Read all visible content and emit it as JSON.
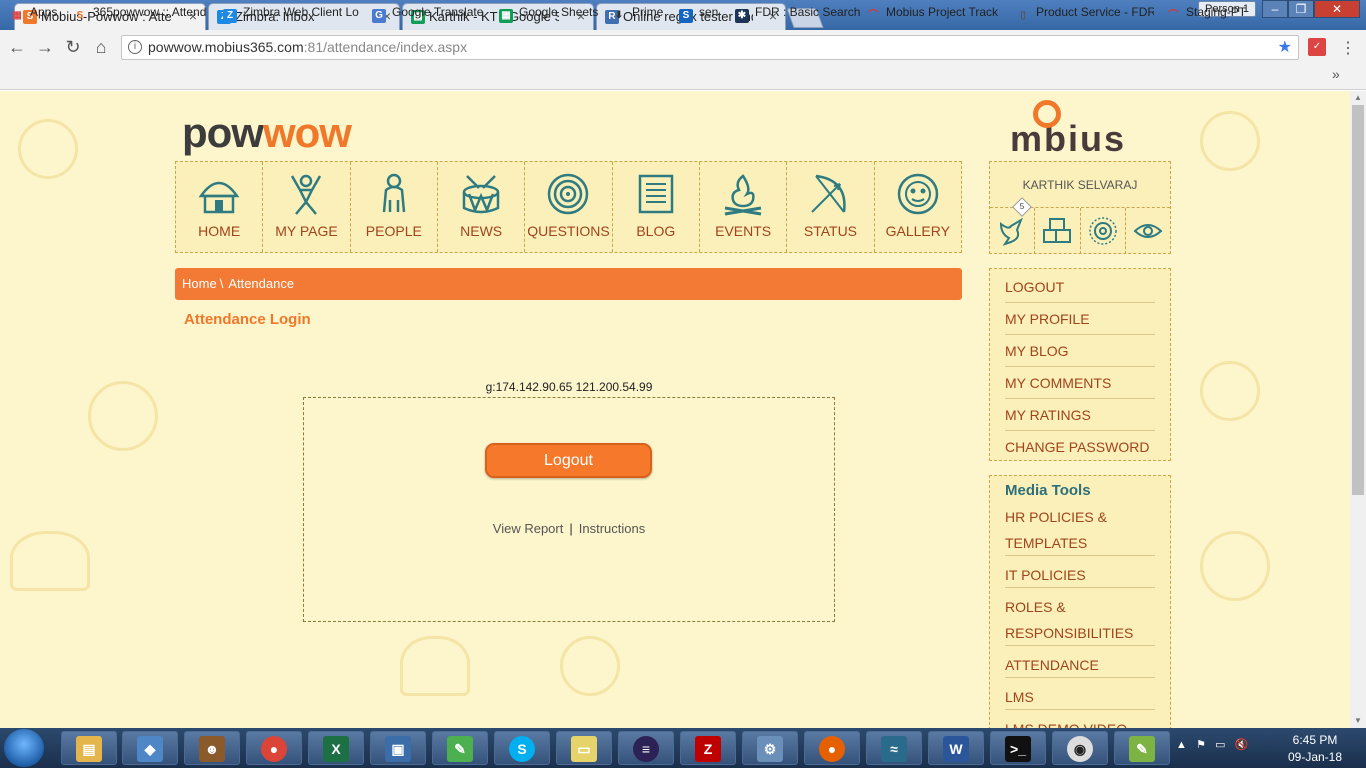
{
  "browser": {
    "tabs": [
      {
        "title": "Mobius-Powwow : Attend",
        "icon": "powwow-icon",
        "color": "#f0782a"
      },
      {
        "title": "Zimbra: Inbox",
        "icon": "zimbra-icon",
        "color": "#1e88e5"
      },
      {
        "title": "Karthik - KT - Google She",
        "icon": "sheets-icon",
        "color": "#0f9d58"
      },
      {
        "title": "Online regex tester and d",
        "icon": "regex-icon",
        "color": "#3f6fb0"
      }
    ],
    "person": "Person 1",
    "url_host": "powwow.mobius365.com",
    "url_path": ":81/attendance/index.aspx",
    "bookmarks": [
      {
        "label": "Apps",
        "icon": "apps-icon"
      },
      {
        "label": "365powwow :: Attend",
        "icon": "powwow-icon"
      },
      {
        "label": "Zimbra Web Client Lo",
        "icon": "zimbra-icon"
      },
      {
        "label": "Google Translate",
        "icon": "translate-icon"
      },
      {
        "label": "Google Sheets",
        "icon": "sheets-icon"
      },
      {
        "label": "Prime",
        "icon": "prime-icon"
      },
      {
        "label": "sen",
        "icon": "skype-icon"
      },
      {
        "label": "FDR : Basic Search",
        "icon": "fdr-icon"
      },
      {
        "label": "Mobius Project Track",
        "icon": "mobius-icon"
      },
      {
        "label": "Product Service - FDR",
        "icon": "page-icon"
      },
      {
        "label": "Staging-PT",
        "icon": "mobius-icon"
      }
    ]
  },
  "site": {
    "logo_left_a": "pow",
    "logo_left_b": "wow",
    "logo_right": "mbius",
    "nav": [
      {
        "label": "HOME",
        "icon": "hut-icon"
      },
      {
        "label": "MY PAGE",
        "icon": "dancer-icon"
      },
      {
        "label": "PEOPLE",
        "icon": "person-icon"
      },
      {
        "label": "NEWS",
        "icon": "drum-icon"
      },
      {
        "label": "QUESTIONS",
        "icon": "spiral-icon"
      },
      {
        "label": "BLOG",
        "icon": "scroll-icon"
      },
      {
        "label": "EVENTS",
        "icon": "bonfire-icon"
      },
      {
        "label": "STATUS",
        "icon": "bow-arrow-icon"
      },
      {
        "label": "GALLERY",
        "icon": "mask-icon"
      }
    ],
    "breadcrumb": {
      "home": "Home",
      "sep": "\\",
      "current": "Attendance"
    },
    "page_title": "Attendance Login",
    "ip_text": "g:174.142.90.65 121.200.54.99",
    "logout_button": "Logout",
    "view_report": "View Report",
    "link_sep": "|",
    "instructions": "Instructions",
    "user": {
      "name": "KARTHIK SELVARAJ",
      "badge_count": "5",
      "icons": [
        "dove-icon",
        "boxes-icon",
        "sun-icon",
        "eye-icon"
      ]
    },
    "user_menu": [
      "LOGOUT",
      "MY PROFILE",
      "MY BLOG",
      "MY COMMENTS",
      "MY RATINGS",
      "CHANGE PASSWORD"
    ],
    "media_tools": {
      "title": "Media Tools",
      "items": [
        {
          "lines": [
            "HR POLICIES &",
            "TEMPLATES"
          ]
        },
        {
          "lines": [
            "IT POLICIES"
          ]
        },
        {
          "lines": [
            "ROLES &",
            "RESPONSIBILITIES"
          ]
        },
        {
          "lines": [
            "ATTENDANCE"
          ]
        },
        {
          "lines": [
            "LMS"
          ]
        },
        {
          "lines": [
            "LMS DEMO VIDEO"
          ]
        }
      ]
    }
  },
  "taskbar": {
    "apps": [
      "explorer-icon",
      "virtualbox-icon",
      "tasmanian-icon",
      "chrome-icon",
      "excel-icon",
      "remote-desktop-icon",
      "notepad-icon",
      "skype-icon",
      "sticky-notes-icon",
      "eclipse-icon",
      "filezilla-icon",
      "network-icon",
      "firefox-icon",
      "mysql-icon",
      "word-icon",
      "cmd-icon",
      "browser-icon",
      "editor-icon"
    ],
    "time": "6:45 PM",
    "date": "09-Jan-18"
  }
}
